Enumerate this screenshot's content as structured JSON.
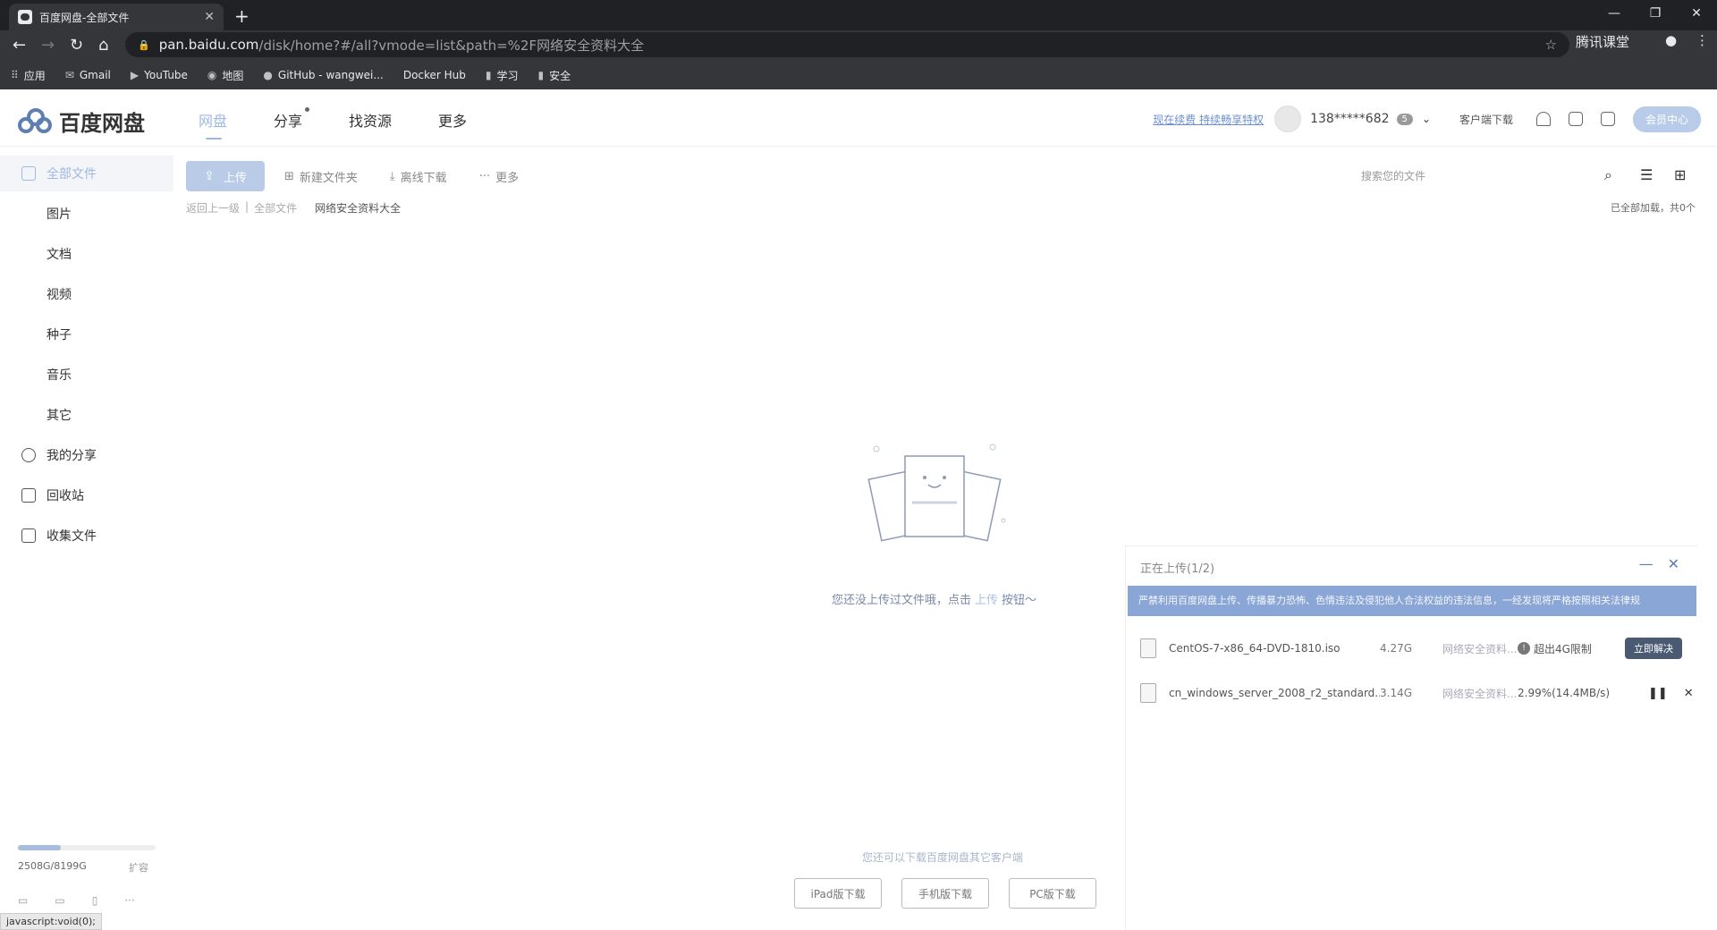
{
  "browser": {
    "tab_title": "百度网盘-全部文件",
    "url_host": "pan.baidu.com",
    "url_path": "/disk/home?#/all?vmode=list&path=%2F网络安全资料大全",
    "ext_label": "腾讯课堂",
    "bookmarks": [
      {
        "icon": "apps-icon",
        "label": "应用"
      },
      {
        "icon": "gmail-icon",
        "label": "Gmail"
      },
      {
        "icon": "youtube-icon",
        "label": "YouTube"
      },
      {
        "icon": "maps-icon",
        "label": "地图"
      },
      {
        "icon": "github-icon",
        "label": "GitHub - wangwei..."
      },
      {
        "icon": "docker-icon",
        "label": "Docker Hub"
      },
      {
        "icon": "folder-icon",
        "label": "学习"
      },
      {
        "icon": "folder-icon",
        "label": "安全"
      }
    ]
  },
  "header": {
    "logo_text": "百度网盘",
    "nav": [
      "网盘",
      "分享",
      "找资源",
      "更多"
    ],
    "promo": "现在续费 持续畅享特权",
    "username": "138*****682",
    "badge": "5",
    "client_download": "客户端下载",
    "vip_center": "会员中心"
  },
  "sidebar": {
    "items": [
      "全部文件",
      "图片",
      "文档",
      "视频",
      "种子",
      "音乐",
      "其它",
      "我的分享",
      "回收站",
      "收集文件"
    ],
    "quota": "2508G/8199G",
    "quota_fraction": 0.31,
    "expand": "扩容",
    "status_tip": "javascript:void(0);"
  },
  "toolbar": {
    "upload": "上传",
    "new_folder": "新建文件夹",
    "offline_download": "离线下载",
    "more": "更多",
    "search_placeholder": "搜索您的文件"
  },
  "breadcrumb": {
    "back": "返回上一级",
    "all": "全部文件",
    "current": "网络安全资料大全",
    "loaded": "已全部加载，共0个"
  },
  "empty": {
    "text_before": "您还没上传过文件哦，点击",
    "link": "上传",
    "text_after": "按钮～",
    "download_hint": "您还可以下载百度网盘其它客户端",
    "buttons": [
      "iPad版下载",
      "手机版下载",
      "PC版下载"
    ]
  },
  "upload_panel": {
    "title": "正在上传(1/2)",
    "notice": "严禁利用百度网盘上传、传播暴力恐怖、色情违法及侵犯他人合法权益的违法信息，一经发现将严格按照相关法律规",
    "rows": [
      {
        "name": "CentOS-7-x86_64-DVD-1810.iso",
        "size": "4.27G",
        "dest": "网络安全资料...",
        "status": "超出4G限制",
        "action": "立即解决"
      },
      {
        "name": "cn_windows_server_2008_r2_standard...",
        "size": "3.14G",
        "dest": "网络安全资料...",
        "status": "2.99%(14.4MB/s)",
        "action": ""
      }
    ]
  }
}
